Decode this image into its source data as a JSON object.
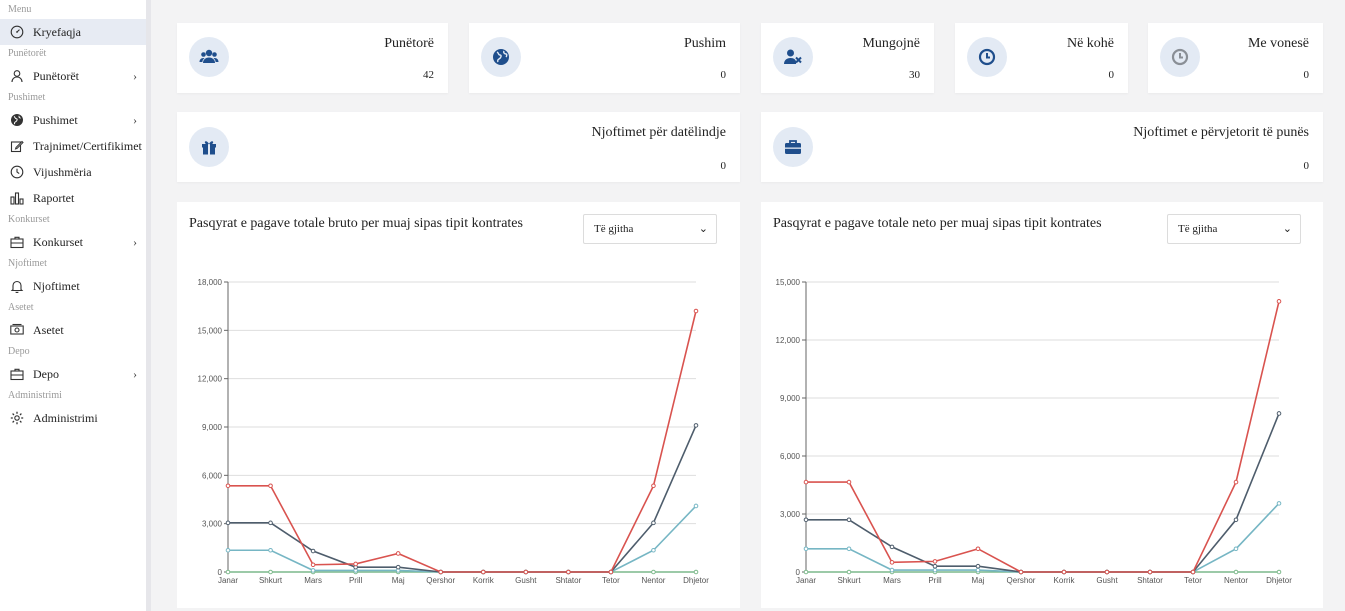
{
  "sidebar": {
    "sections": [
      {
        "label": "Menu",
        "items": [
          {
            "label": "Kryefaqja",
            "icon": "dashboard-icon",
            "active": true
          }
        ]
      },
      {
        "label": "Punëtorët",
        "items": [
          {
            "label": "Punëtorët",
            "icon": "user-icon",
            "chevron": true
          }
        ]
      },
      {
        "label": "Pushimet",
        "items": [
          {
            "label": "Pushimet",
            "icon": "globe-icon",
            "chevron": true
          },
          {
            "label": "Trajnimet/Certifikimet",
            "icon": "edit-icon"
          },
          {
            "label": "Vijushmëria",
            "icon": "clock-icon"
          },
          {
            "label": "Raportet",
            "icon": "chart-icon"
          }
        ]
      },
      {
        "label": "Konkurset",
        "items": [
          {
            "label": "Konkurset",
            "icon": "briefcase-icon",
            "chevron": true
          }
        ]
      },
      {
        "label": "Njoftimet",
        "items": [
          {
            "label": "Njoftimet",
            "icon": "bell-icon"
          }
        ]
      },
      {
        "label": "Asetet",
        "items": [
          {
            "label": "Asetet",
            "icon": "money-icon"
          }
        ]
      },
      {
        "label": "Depo",
        "items": [
          {
            "label": "Depo",
            "icon": "briefcase-icon",
            "chevron": true
          }
        ]
      },
      {
        "label": "Administrimi",
        "items": [
          {
            "label": "Administrimi",
            "icon": "settings-icon"
          }
        ]
      }
    ],
    "chevron_glyph": "›"
  },
  "stats": [
    {
      "title": "Punëtorë",
      "value": "42",
      "icon": "users-icon"
    },
    {
      "title": "Pushim",
      "value": "0",
      "icon": "globe-icon"
    },
    {
      "title": "Mungojnë",
      "value": "30",
      "icon": "user-x-icon"
    },
    {
      "title": "Në kohë",
      "value": "0",
      "icon": "clock-icon"
    },
    {
      "title": "Me vonesë",
      "value": "0",
      "icon": "clock-gray-icon"
    }
  ],
  "notifications": [
    {
      "title": "Njoftimet për datëlindje",
      "value": "0",
      "icon": "gift-icon"
    },
    {
      "title": "Njoftimet e përvjetorit të punës",
      "value": "0",
      "icon": "briefcase-icon"
    }
  ],
  "colors": {
    "accent": "#1f4e8c",
    "series_red": "#d9534f",
    "series_dark": "#4e5d6c",
    "series_teal": "#76b6c4",
    "series_green": "#7cb98b"
  },
  "charts": [
    {
      "title": "Pasqyrat e pagave totale bruto per muaj sipas tipit kontrates",
      "select": "Të gjitha"
    },
    {
      "title": "Pasqyrat e pagave totale neto per muaj sipas tipit kontrates",
      "select": "Të gjitha"
    }
  ],
  "chart_data": [
    {
      "type": "line",
      "title": "Pasqyrat e pagave totale bruto per muaj sipas tipit kontrates",
      "categories": [
        "Janar",
        "Shkurt",
        "Mars",
        "Prill",
        "Maj",
        "Qershor",
        "Korrik",
        "Gusht",
        "Shtator",
        "Tetor",
        "Nentor",
        "Dhjetor"
      ],
      "ylim": [
        0,
        18000
      ],
      "yticks": [
        "0",
        "3,000",
        "6,000",
        "9,000",
        "12,000",
        "15,000",
        "18,000"
      ],
      "grid": true,
      "series": [
        {
          "color": "#d9534f",
          "values": [
            5350,
            5350,
            450,
            500,
            1150,
            0,
            0,
            0,
            0,
            0,
            5350,
            16200
          ]
        },
        {
          "color": "#4e5d6c",
          "values": [
            3050,
            3050,
            1300,
            300,
            300,
            0,
            0,
            0,
            0,
            0,
            3050,
            9100
          ]
        },
        {
          "color": "#76b6c4",
          "values": [
            1350,
            1350,
            100,
            100,
            100,
            0,
            0,
            0,
            0,
            0,
            1350,
            4100
          ]
        },
        {
          "color": "#7cb98b",
          "values": [
            0,
            0,
            0,
            0,
            0,
            0,
            0,
            0,
            0,
            0,
            0,
            0
          ]
        }
      ]
    },
    {
      "type": "line",
      "title": "Pasqyrat e pagave totale neto per muaj sipas tipit kontrates",
      "categories": [
        "Janar",
        "Shkurt",
        "Mars",
        "Prill",
        "Maj",
        "Qershor",
        "Korrik",
        "Gusht",
        "Shtator",
        "Tetor",
        "Nentor",
        "Dhjetor"
      ],
      "ylim": [
        0,
        15000
      ],
      "yticks": [
        "0",
        "3,000",
        "6,000",
        "9,000",
        "12,000",
        "15,000"
      ],
      "grid": true,
      "series": [
        {
          "color": "#d9534f",
          "values": [
            4650,
            4650,
            500,
            550,
            1200,
            0,
            0,
            0,
            0,
            0,
            4650,
            14000
          ]
        },
        {
          "color": "#4e5d6c",
          "values": [
            2700,
            2700,
            1300,
            300,
            300,
            0,
            0,
            0,
            0,
            0,
            2700,
            8200
          ]
        },
        {
          "color": "#76b6c4",
          "values": [
            1200,
            1200,
            100,
            100,
            100,
            0,
            0,
            0,
            0,
            0,
            1200,
            3550
          ]
        },
        {
          "color": "#7cb98b",
          "values": [
            0,
            0,
            0,
            0,
            0,
            0,
            0,
            0,
            0,
            0,
            0,
            0
          ]
        }
      ]
    }
  ]
}
